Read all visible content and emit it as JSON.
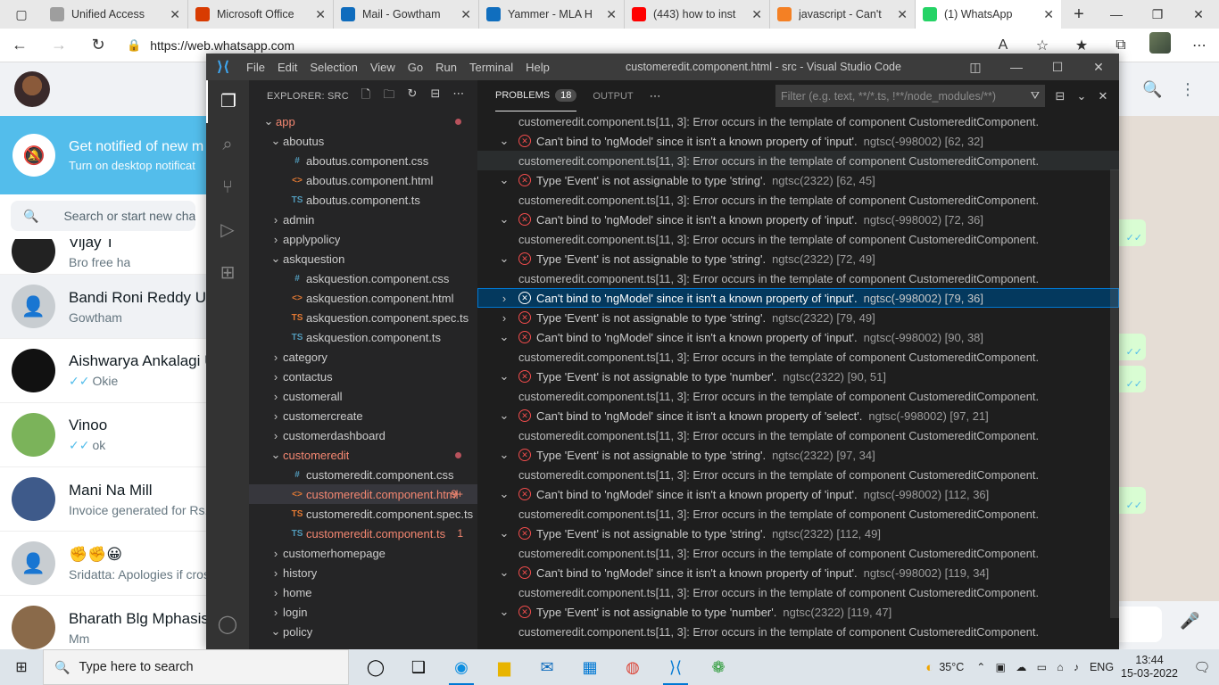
{
  "browser": {
    "tabs": [
      {
        "title": "Unified Access",
        "favicon_color": "#9e9e9e",
        "active": false
      },
      {
        "title": "Microsoft Office",
        "favicon_color": "#d83b01",
        "active": false
      },
      {
        "title": "Mail - Gowtham",
        "favicon_color": "#0f6cbd",
        "active": false
      },
      {
        "title": "Yammer - MLA H",
        "favicon_color": "#106ebe",
        "active": false
      },
      {
        "title": "(443) how to inst",
        "favicon_color": "#ff0000",
        "active": false
      },
      {
        "title": "javascript - Can't",
        "favicon_color": "#f48024",
        "active": false
      },
      {
        "title": "(1) WhatsApp",
        "favicon_color": "#25d366",
        "active": true
      }
    ],
    "url": "https://web.whatsapp.com"
  },
  "whatsapp": {
    "notify_title": "Get notified of new m",
    "notify_subtitle": "Turn on desktop notificat",
    "search_placeholder": "Search or start new chat",
    "chats": [
      {
        "name": "Vijay T",
        "last": "Bro free ha",
        "ticks": false
      },
      {
        "name": "Bandi Roni Reddy Ui/",
        "last": "Gowtham",
        "ticks": false
      },
      {
        "name": "Aishwarya Ankalagi U",
        "last": "Okie",
        "ticks": true
      },
      {
        "name": "Vinoo",
        "last": "ok",
        "ticks": true
      },
      {
        "name": "Mani Na Mill",
        "last": "Invoice generated for Rs.",
        "ticks": false
      },
      {
        "name": "✊✊😀",
        "last": "Sridatta: Apologies if cros",
        "ticks": false
      },
      {
        "name": "Bharath Blg Mphasis",
        "last": "Mm",
        "ticks": false
      }
    ]
  },
  "vscode": {
    "menu": [
      "File",
      "Edit",
      "Selection",
      "View",
      "Go",
      "Run",
      "Terminal",
      "Help"
    ],
    "window_title": "customeredit.component.html - src - Visual Studio Code",
    "explorer_title": "EXPLORER: SRC",
    "tree": [
      {
        "label": "app",
        "kind": "folder",
        "depth": 0,
        "open": true,
        "error": true,
        "dot": true
      },
      {
        "label": "aboutus",
        "kind": "folder",
        "depth": 1,
        "open": true
      },
      {
        "label": "aboutus.component.css",
        "kind": "css",
        "depth": 2
      },
      {
        "label": "aboutus.component.html",
        "kind": "html",
        "depth": 2
      },
      {
        "label": "aboutus.component.ts",
        "kind": "ts",
        "depth": 2
      },
      {
        "label": "admin",
        "kind": "folder",
        "depth": 1,
        "open": false
      },
      {
        "label": "applypolicy",
        "kind": "folder",
        "depth": 1,
        "open": false
      },
      {
        "label": "askquestion",
        "kind": "folder",
        "depth": 1,
        "open": true
      },
      {
        "label": "askquestion.component.css",
        "kind": "css",
        "depth": 2
      },
      {
        "label": "askquestion.component.html",
        "kind": "html",
        "depth": 2
      },
      {
        "label": "askquestion.component.spec.ts",
        "kind": "spec",
        "depth": 2
      },
      {
        "label": "askquestion.component.ts",
        "kind": "ts",
        "depth": 2
      },
      {
        "label": "category",
        "kind": "folder",
        "depth": 1,
        "open": false
      },
      {
        "label": "contactus",
        "kind": "folder",
        "depth": 1,
        "open": false
      },
      {
        "label": "customerall",
        "kind": "folder",
        "depth": 1,
        "open": false
      },
      {
        "label": "customercreate",
        "kind": "folder",
        "depth": 1,
        "open": false
      },
      {
        "label": "customerdashboard",
        "kind": "folder",
        "depth": 1,
        "open": false
      },
      {
        "label": "customeredit",
        "kind": "folder",
        "depth": 1,
        "open": true,
        "error": true,
        "dot": true
      },
      {
        "label": "customeredit.component.css",
        "kind": "css",
        "depth": 2
      },
      {
        "label": "customeredit.component.html",
        "kind": "html",
        "depth": 2,
        "error": true,
        "selected": true,
        "badge": "9+"
      },
      {
        "label": "customeredit.component.spec.ts",
        "kind": "spec",
        "depth": 2
      },
      {
        "label": "customeredit.component.ts",
        "kind": "ts",
        "depth": 2,
        "error": true,
        "badge": "1"
      },
      {
        "label": "customerhomepage",
        "kind": "folder",
        "depth": 1,
        "open": false
      },
      {
        "label": "history",
        "kind": "folder",
        "depth": 1,
        "open": false
      },
      {
        "label": "home",
        "kind": "folder",
        "depth": 1,
        "open": false
      },
      {
        "label": "login",
        "kind": "folder",
        "depth": 1,
        "open": false
      },
      {
        "label": "policy",
        "kind": "folder",
        "depth": 1,
        "open": true
      }
    ],
    "panel": {
      "problems_label": "PROBLEMS",
      "problems_count": "18",
      "output_label": "OUTPUT",
      "filter_placeholder": "Filter (e.g. text, **/*.ts, !**/node_modules/**)"
    },
    "problems": [
      {
        "type": "detail",
        "text": "customeredit.component.ts[11, 3]: Error occurs in the template of component CustomereditComponent."
      },
      {
        "type": "issue",
        "msg": "Can't bind to 'ngModel' since it isn't a known property of 'input'.",
        "src": "ngtsc(-998002)  [62, 32]",
        "open": true
      },
      {
        "type": "detail",
        "text": "customeredit.component.ts[11, 3]: Error occurs in the template of component CustomereditComponent.",
        "hover": true
      },
      {
        "type": "issue",
        "msg": "Type 'Event' is not assignable to type 'string'.",
        "src": "ngtsc(2322)  [62, 45]",
        "open": true
      },
      {
        "type": "detail",
        "text": "customeredit.component.ts[11, 3]: Error occurs in the template of component CustomereditComponent."
      },
      {
        "type": "issue",
        "msg": "Can't bind to 'ngModel' since it isn't a known property of 'input'.",
        "src": "ngtsc(-998002)  [72, 36]",
        "open": true
      },
      {
        "type": "detail",
        "text": "customeredit.component.ts[11, 3]: Error occurs in the template of component CustomereditComponent."
      },
      {
        "type": "issue",
        "msg": "Type 'Event' is not assignable to type 'string'.",
        "src": "ngtsc(2322)  [72, 49]",
        "open": true
      },
      {
        "type": "detail",
        "text": "customeredit.component.ts[11, 3]: Error occurs in the template of component CustomereditComponent."
      },
      {
        "type": "issue",
        "msg": "Can't bind to 'ngModel' since it isn't a known property of 'input'.",
        "src": "ngtsc(-998002)  [79, 36]",
        "open": false,
        "selected": true
      },
      {
        "type": "issue",
        "msg": "Type 'Event' is not assignable to type 'string'.",
        "src": "ngtsc(2322)  [79, 49]",
        "open": false
      },
      {
        "type": "issue",
        "msg": "Can't bind to 'ngModel' since it isn't a known property of 'input'.",
        "src": "ngtsc(-998002)  [90, 38]",
        "open": true
      },
      {
        "type": "detail",
        "text": "customeredit.component.ts[11, 3]: Error occurs in the template of component CustomereditComponent."
      },
      {
        "type": "issue",
        "msg": "Type 'Event' is not assignable to type 'number'.",
        "src": "ngtsc(2322)  [90, 51]",
        "open": true
      },
      {
        "type": "detail",
        "text": "customeredit.component.ts[11, 3]: Error occurs in the template of component CustomereditComponent."
      },
      {
        "type": "issue",
        "msg": "Can't bind to 'ngModel' since it isn't a known property of 'select'.",
        "src": "ngtsc(-998002)  [97, 21]",
        "open": true
      },
      {
        "type": "detail",
        "text": "customeredit.component.ts[11, 3]: Error occurs in the template of component CustomereditComponent."
      },
      {
        "type": "issue",
        "msg": "Type 'Event' is not assignable to type 'string'.",
        "src": "ngtsc(2322)  [97, 34]",
        "open": true
      },
      {
        "type": "detail",
        "text": "customeredit.component.ts[11, 3]: Error occurs in the template of component CustomereditComponent."
      },
      {
        "type": "issue",
        "msg": "Can't bind to 'ngModel' since it isn't a known property of 'input'.",
        "src": "ngtsc(-998002)  [112, 36]",
        "open": true
      },
      {
        "type": "detail",
        "text": "customeredit.component.ts[11, 3]: Error occurs in the template of component CustomereditComponent."
      },
      {
        "type": "issue",
        "msg": "Type 'Event' is not assignable to type 'string'.",
        "src": "ngtsc(2322)  [112, 49]",
        "open": true
      },
      {
        "type": "detail",
        "text": "customeredit.component.ts[11, 3]: Error occurs in the template of component CustomereditComponent."
      },
      {
        "type": "issue",
        "msg": "Can't bind to 'ngModel' since it isn't a known property of 'input'.",
        "src": "ngtsc(-998002)  [119, 34]",
        "open": true
      },
      {
        "type": "detail",
        "text": "customeredit.component.ts[11, 3]: Error occurs in the template of component CustomereditComponent."
      },
      {
        "type": "issue",
        "msg": "Type 'Event' is not assignable to type 'number'.",
        "src": "ngtsc(2322)  [119, 47]",
        "open": true
      },
      {
        "type": "detail",
        "text": "customeredit.component.ts[11, 3]: Error occurs in the template of component CustomereditComponent."
      }
    ]
  },
  "taskbar": {
    "search_placeholder": "Type here to search",
    "weather": "35°C",
    "language": "ENG",
    "time": "13:44",
    "date": "15-03-2022"
  }
}
